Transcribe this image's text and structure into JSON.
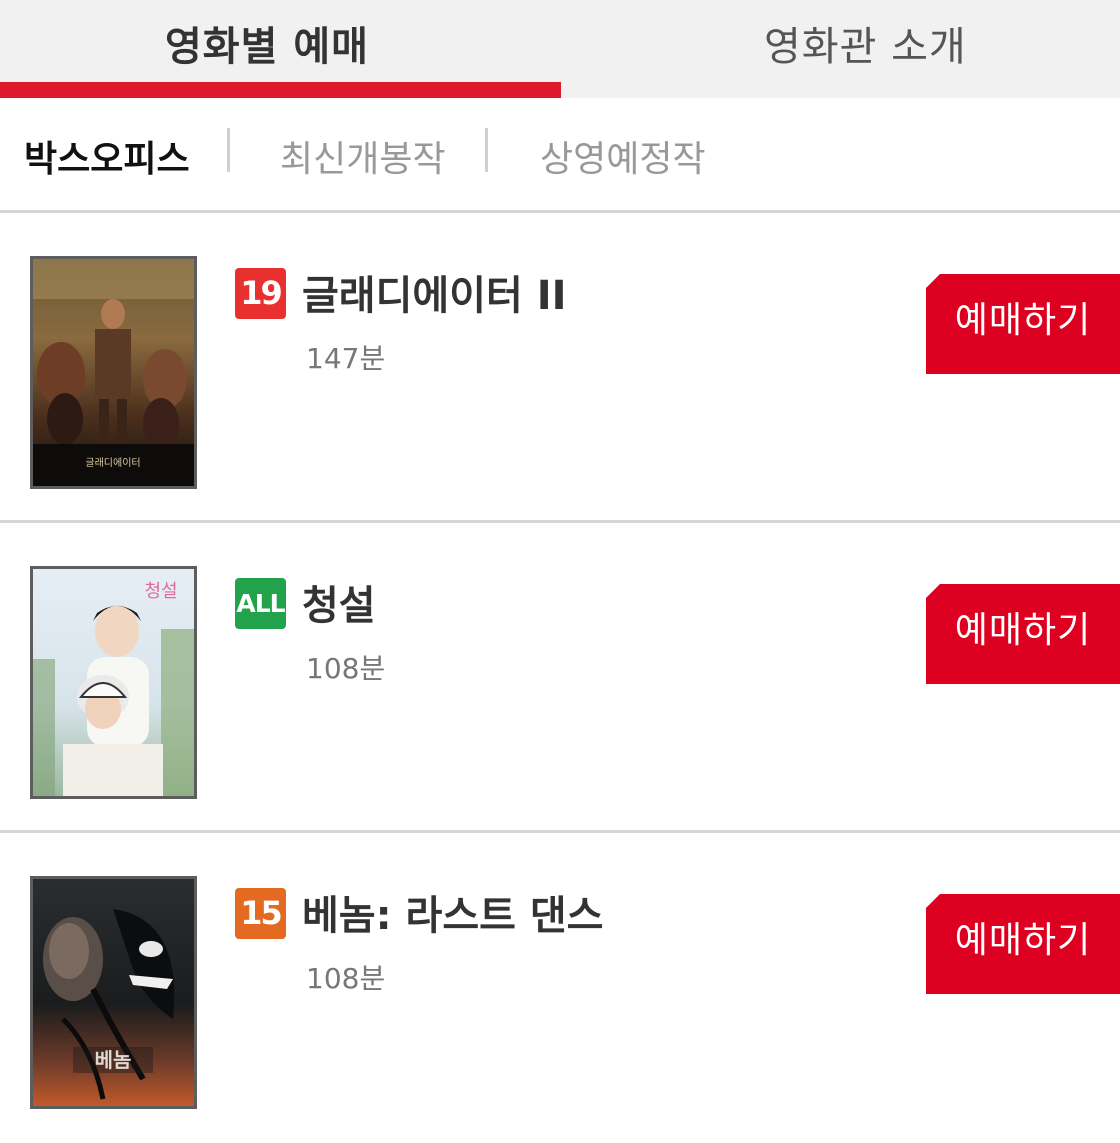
{
  "top_tabs": {
    "by_movie": "영화별 예매",
    "theater_intro": "영화관 소개"
  },
  "sub_tabs": {
    "box_office": "박스오피스",
    "latest": "최신개봉작",
    "upcoming": "상영예정작"
  },
  "movies": [
    {
      "title": "글래디에이터 II",
      "rating": "19",
      "rating_color": "#e8302f",
      "duration": "147분",
      "book_label": "예매하기",
      "poster_text": "글래디에이터"
    },
    {
      "title": "청설",
      "rating": "ALL",
      "rating_color": "#22a24a",
      "duration": "108분",
      "book_label": "예매하기",
      "poster_text": "청설"
    },
    {
      "title": "베놈: 라스트 댄스",
      "rating": "15",
      "rating_color": "#e46a21",
      "duration": "108분",
      "book_label": "예매하기",
      "poster_text": "베놈"
    }
  ],
  "colors": {
    "accent": "#dd1a2b",
    "button": "#dd0020"
  }
}
